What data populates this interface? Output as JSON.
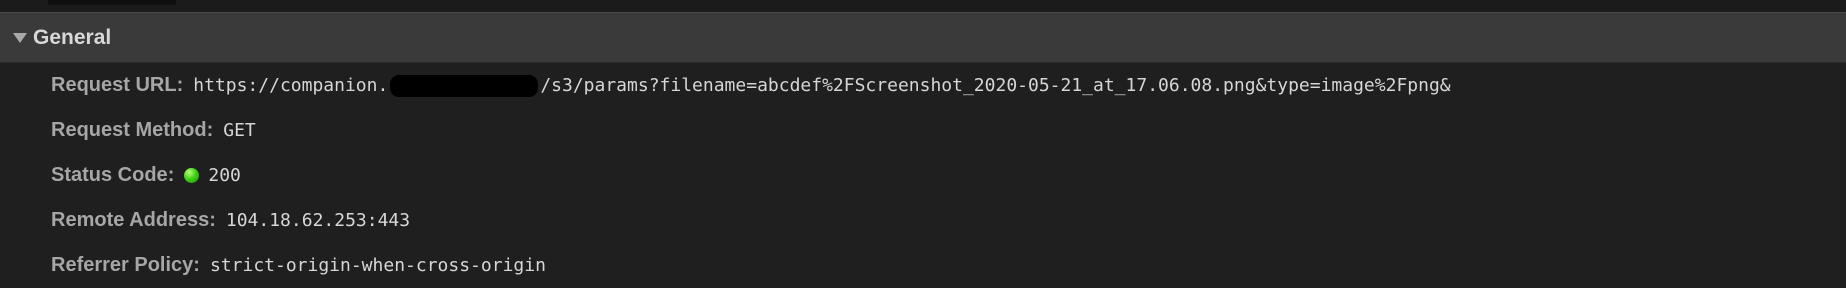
{
  "section": {
    "title": "General",
    "expanded": true
  },
  "rows": [
    {
      "label": "Request URL",
      "value_prefix": "https://companion.",
      "value_suffix": "/s3/params?filename=abcdef%2FScreenshot_2020-05-21_at_17.06.08.png&type=image%2Fpng&"
    },
    {
      "label": "Request Method",
      "value": "GET"
    },
    {
      "label": "Status Code",
      "value": "200",
      "status_color": "#3fd413"
    },
    {
      "label": "Remote Address",
      "value": "104.18.62.253:443"
    },
    {
      "label": "Referrer Policy",
      "value": "strict-origin-when-cross-origin"
    }
  ],
  "colors": {
    "header_bg": "#3a3a3a",
    "panel_bg": "#1f1f1f",
    "label": "#a6a6a6",
    "value": "#d6d6d6",
    "status_ok": "#3fd413"
  },
  "icons": {
    "collapse": "triangle-down-icon",
    "status": "status-ok-dot-icon"
  }
}
